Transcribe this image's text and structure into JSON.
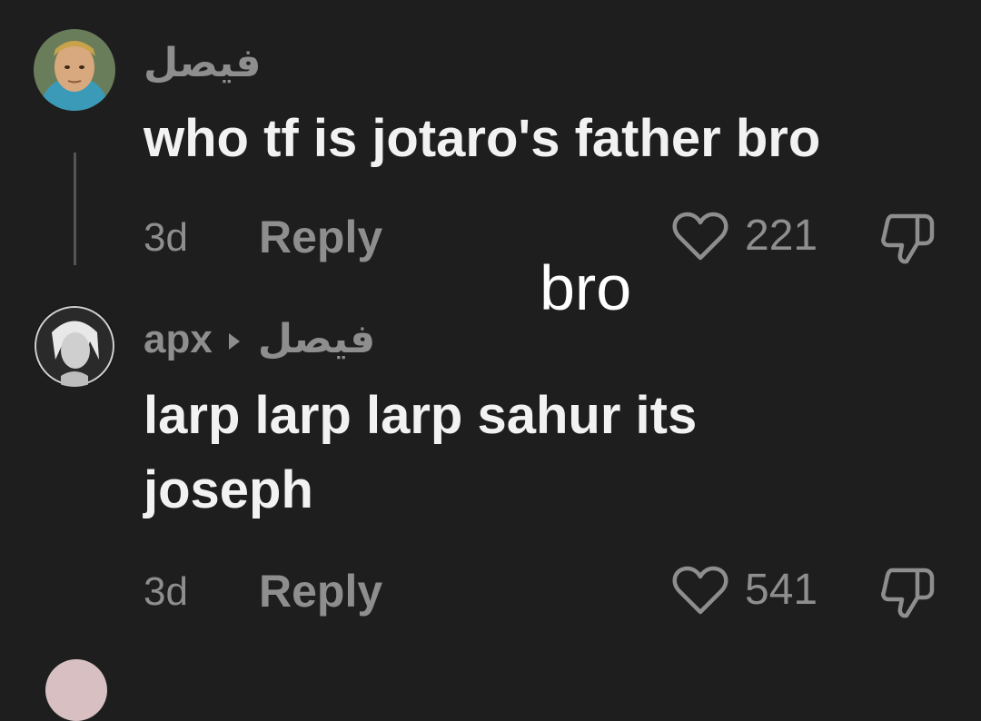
{
  "overlay": {
    "caption": "bro"
  },
  "comments": [
    {
      "username": "فيصل",
      "text": "who tf is jotaro's father bro",
      "time": "3d",
      "reply_label": "Reply",
      "likes": "221",
      "avatar_icon": "user-avatar-blonde-man",
      "like_icon": "heart-outline-icon",
      "dislike_icon": "thumbs-down-icon"
    },
    {
      "username": "apx",
      "reply_to": "فيصل",
      "text_line1": "larp larp larp sahur its",
      "text_line2": "joseph",
      "time": "3d",
      "reply_label": "Reply",
      "likes": "541",
      "avatar_icon": "user-avatar-anime-character",
      "like_icon": "heart-outline-icon",
      "dislike_icon": "thumbs-down-icon"
    }
  ],
  "colors": {
    "background": "#1e1e1e",
    "primary_text": "#f2f2f2",
    "secondary_text": "#8e8e8e"
  }
}
